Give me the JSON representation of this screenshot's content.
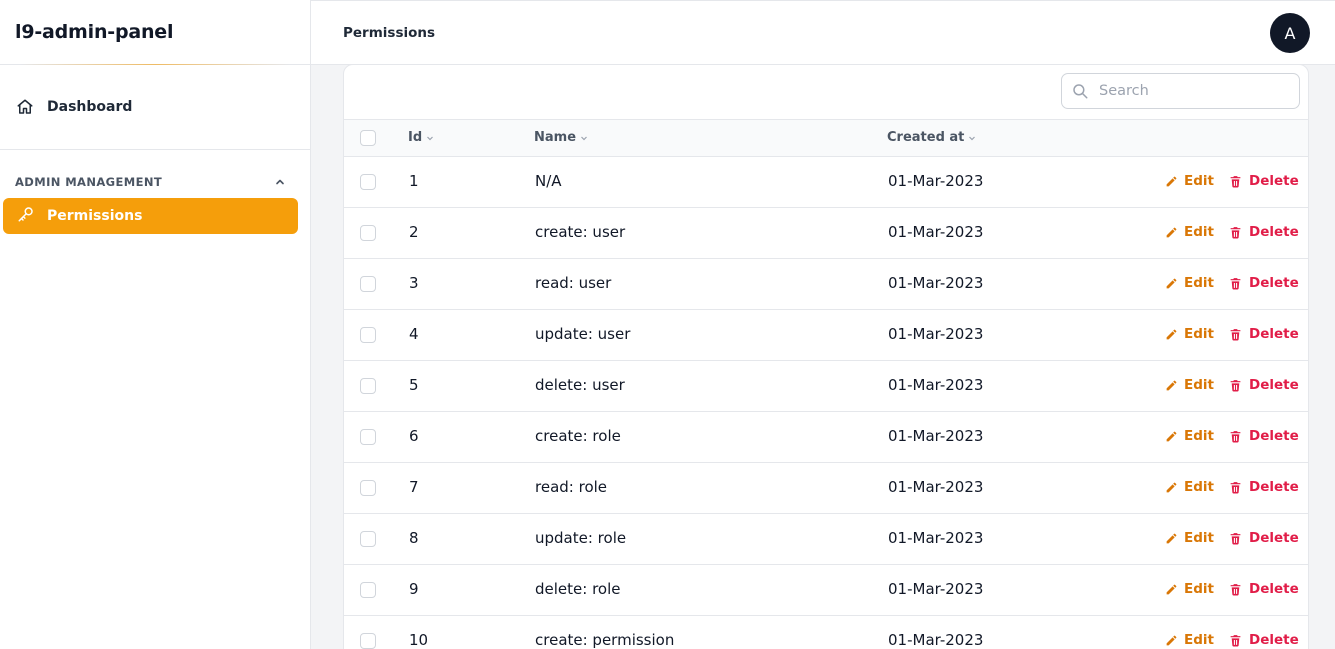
{
  "sidebar": {
    "brand": "l9-admin-panel",
    "dashboard_label": "Dashboard",
    "group_title": "ADMIN MANAGEMENT",
    "active_item_label": "Permissions"
  },
  "topbar": {
    "title": "Permissions",
    "avatar_initial": "A"
  },
  "search": {
    "placeholder": "Search",
    "value": ""
  },
  "table": {
    "headers": {
      "id": "Id",
      "name": "Name",
      "created_at": "Created at"
    },
    "edit_label": "Edit",
    "delete_label": "Delete",
    "rows": [
      {
        "id": "1",
        "name": "N/A",
        "created_at": "01-Mar-2023"
      },
      {
        "id": "2",
        "name": "create: user",
        "created_at": "01-Mar-2023"
      },
      {
        "id": "3",
        "name": "read: user",
        "created_at": "01-Mar-2023"
      },
      {
        "id": "4",
        "name": "update: user",
        "created_at": "01-Mar-2023"
      },
      {
        "id": "5",
        "name": "delete: user",
        "created_at": "01-Mar-2023"
      },
      {
        "id": "6",
        "name": "create: role",
        "created_at": "01-Mar-2023"
      },
      {
        "id": "7",
        "name": "read: role",
        "created_at": "01-Mar-2023"
      },
      {
        "id": "8",
        "name": "update: role",
        "created_at": "01-Mar-2023"
      },
      {
        "id": "9",
        "name": "delete: role",
        "created_at": "01-Mar-2023"
      },
      {
        "id": "10",
        "name": "create: permission",
        "created_at": "01-Mar-2023"
      }
    ]
  },
  "icons": {
    "dashboard": "home-icon",
    "permissions": "key-icon",
    "group_toggle": "chevron-up-icon",
    "search": "search-icon",
    "sort": "caret-down-icon",
    "edit": "pencil-icon",
    "delete": "trash-icon"
  },
  "colors": {
    "accent": "#f59e0b",
    "edit": "#d97706",
    "delete": "#e11d48",
    "avatar_bg": "#111827"
  }
}
